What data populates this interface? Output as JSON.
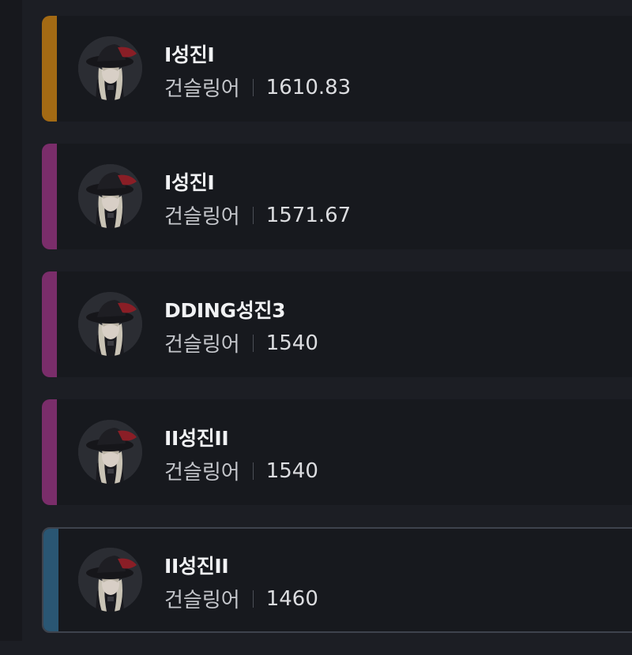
{
  "characters": [
    {
      "name": "I성진I",
      "class": "건슬링어",
      "item_level": "1610.83",
      "accent_color": "#a36a14",
      "selected": false
    },
    {
      "name": "I성진I",
      "class": "건슬링어",
      "item_level": "1571.67",
      "accent_color": "#7a2d6a",
      "selected": false
    },
    {
      "name": "DDING성진3",
      "class": "건슬링어",
      "item_level": "1540",
      "accent_color": "#7a2d6a",
      "selected": false
    },
    {
      "name": "II성진II",
      "class": "건슬링어",
      "item_level": "1540",
      "accent_color": "#7a2d6a",
      "selected": false
    },
    {
      "name": "II성진II",
      "class": "건슬링어",
      "item_level": "1460",
      "accent_color": "#2a5673",
      "selected": true
    }
  ],
  "avatar_icon": "gunslinger-portrait-icon"
}
